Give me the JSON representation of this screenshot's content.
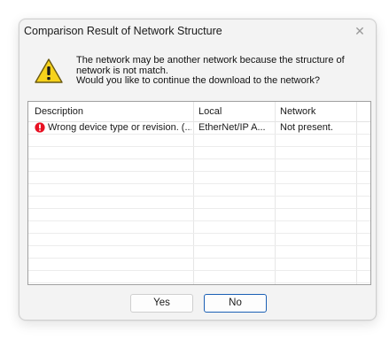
{
  "dialog": {
    "title": "Comparison Result of Network Structure",
    "close_glyph": "✕",
    "message_lines": [
      "The network may be another network because the structure of",
      "network is not match.",
      "Would you like to continue the download to the network?"
    ],
    "warning_icon": "warning-triangle-icon"
  },
  "table": {
    "columns": [
      "Description",
      "Local",
      "Network"
    ],
    "rows": [
      {
        "icon": "error-icon",
        "description": "Wrong device type or revision. (...",
        "local": "EtherNet/IP A...",
        "network": "Not present."
      }
    ]
  },
  "buttons": {
    "yes_label": "Yes",
    "no_label": "No"
  },
  "colors": {
    "error": "#e81123",
    "warning_fill": "#f7d21b",
    "default_button_border": "#1a5fb4"
  }
}
